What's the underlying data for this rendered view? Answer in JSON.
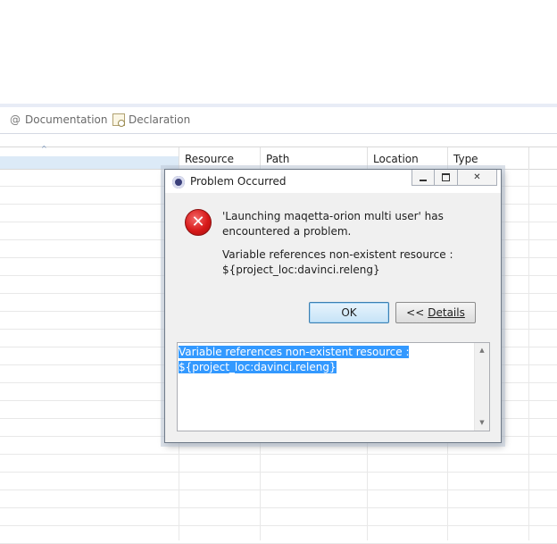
{
  "tabs": [
    {
      "label": "Documentation",
      "icon": "at-sign-icon"
    },
    {
      "label": "Declaration",
      "icon": "declaration-icon"
    }
  ],
  "table": {
    "sort_indicator": "^",
    "columns": [
      "Resource",
      "Path",
      "Location",
      "Type"
    ]
  },
  "dialog": {
    "title": "Problem Occurred",
    "message": "'Launching maqetta-orion multi user' has encountered a problem.",
    "message_line1": "'Launching maqetta-orion multi user' has",
    "message_line2": "encountered a problem.",
    "reason_line1": "Variable references non-existent resource :",
    "reason_line2": "${project_loc:davinci.releng}",
    "ok_label": "OK",
    "details_prefix": "<<",
    "details_label": "Details",
    "details_line1": "Variable references non-existent resource :",
    "details_line2": "${project_loc:davinci.releng}",
    "error_glyph": "✕"
  },
  "colors": {
    "selection": "#3399ff",
    "error_red": "#d71919",
    "header_highlight": "#dceaf7",
    "ok_border": "#3c7fb1"
  }
}
